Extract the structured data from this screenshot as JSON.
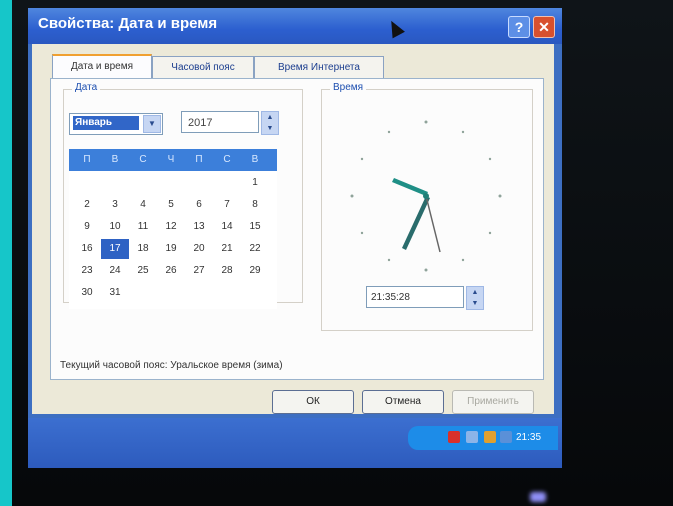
{
  "window": {
    "title": "Свойства: Дата и время",
    "help_label": "?",
    "close_label": "✕"
  },
  "tabs": [
    {
      "label": "Дата и время"
    },
    {
      "label": "Часовой пояс"
    },
    {
      "label": "Время Интернета"
    }
  ],
  "date_group": {
    "label": "Дата",
    "month": "Январь",
    "year": "2017",
    "weekdays": [
      "П",
      "В",
      "С",
      "Ч",
      "П",
      "С",
      "В"
    ],
    "days": [
      "1",
      "2",
      "3",
      "4",
      "5",
      "6",
      "7",
      "8",
      "9",
      "10",
      "11",
      "12",
      "13",
      "14",
      "15",
      "16",
      "17",
      "18",
      "19",
      "20",
      "21",
      "22",
      "23",
      "24",
      "25",
      "26",
      "27",
      "28",
      "29",
      "30",
      "31"
    ],
    "selected_day": "17"
  },
  "time_group": {
    "label": "Время",
    "time": "21:35:28"
  },
  "timezone_text": "Текущий часовой пояс: Уральское время (зима)",
  "buttons": {
    "ok": "ОК",
    "cancel": "Отмена",
    "apply": "Применить"
  },
  "taskbar": {
    "time": "21:35"
  },
  "icons": [
    "help-icon",
    "close-icon",
    "mouse-cursor-icon",
    "dropdown-arrow-icon",
    "spin-up-icon",
    "spin-down-icon",
    "analog-clock-icon",
    "tray-icon"
  ],
  "colors": {
    "title_bar": "#2c5fcf",
    "dialog_bg": "#ece9d8",
    "calendar_header": "#3c7fda",
    "selected_day": "#2e62c4",
    "close_button": "#d8502e"
  }
}
